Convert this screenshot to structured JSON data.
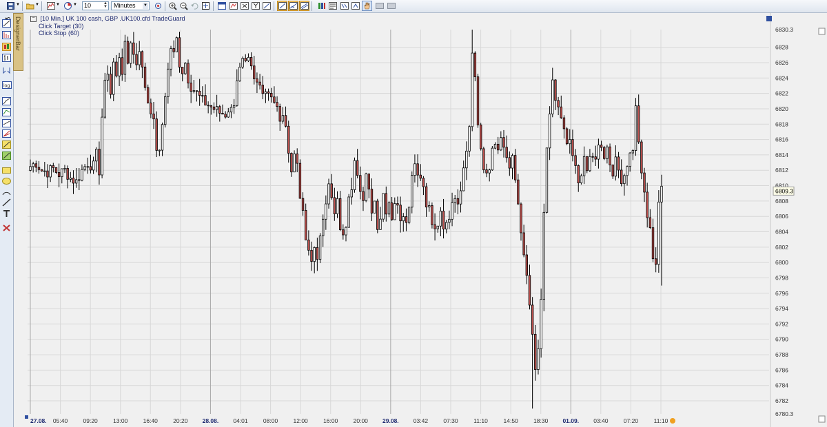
{
  "toolbar": {
    "bar_value": "10",
    "period_unit": "Minutes"
  },
  "designer_bar": {
    "label": "DesignerBar"
  },
  "chart_header": {
    "instrument": "[10 Min.] UK 100 cash, GBP  .UK100.cfd TradeGuard",
    "line2": "Click Target  (30)",
    "line3": "Click Stop  (60)"
  },
  "chart_data": {
    "type": "candlestick",
    "title": "[10 Min.] UK 100 cash, GBP  .UK100.cfd TradeGuard",
    "ylim": [
      6780.3,
      6830.3
    ],
    "y_axis_top_label": "6830.3",
    "y_axis_bottom_label": "6780.3",
    "current_price": "6809.3",
    "y_ticks": [
      "6828",
      "6826",
      "6824",
      "6822",
      "6820",
      "6818",
      "6816",
      "6814",
      "6812",
      "6810",
      "6808",
      "6806",
      "6804",
      "6802",
      "6800",
      "6798",
      "6796",
      "6794",
      "6792",
      "6790",
      "6788",
      "6786",
      "6784",
      "6782"
    ],
    "x_ticks": [
      "27.08.",
      "05:40",
      "09:20",
      "13:00",
      "16:40",
      "20:20",
      "28.08.",
      "04:01",
      "08:00",
      "12:00",
      "16:00",
      "20:00",
      "29.08.",
      "03:42",
      "07:30",
      "11:10",
      "14:50",
      "18:30",
      "01.09.",
      "03:40",
      "07:20",
      "11:10"
    ],
    "date_ticks": [
      "27.08.",
      "28.08.",
      "29.08.",
      "01.09."
    ],
    "close_path": [
      [
        0,
        6812.5
      ],
      [
        2,
        6813
      ],
      [
        4,
        6812
      ],
      [
        6,
        6811.8
      ],
      [
        8,
        6812.2
      ],
      [
        10,
        6811.5
      ],
      [
        12,
        6812
      ],
      [
        14,
        6811
      ],
      [
        16,
        6810.5
      ],
      [
        18,
        6812
      ],
      [
        20,
        6813
      ],
      [
        22,
        6812.5
      ],
      [
        23,
        6814
      ],
      [
        24,
        6812
      ],
      [
        25,
        6819
      ],
      [
        26,
        6823
      ],
      [
        27,
        6825
      ],
      [
        28,
        6822
      ],
      [
        29,
        6826
      ],
      [
        30,
        6824
      ],
      [
        31,
        6827
      ],
      [
        32,
        6825
      ],
      [
        33,
        6828
      ],
      [
        34,
        6826
      ],
      [
        35,
        6829
      ],
      [
        36,
        6827
      ],
      [
        37,
        6826
      ],
      [
        38,
        6828
      ],
      [
        39,
        6825
      ],
      [
        40,
        6823
      ],
      [
        41,
        6821
      ],
      [
        42,
        6820
      ],
      [
        43,
        6818
      ],
      [
        44,
        6815
      ],
      [
        45,
        6814
      ],
      [
        46,
        6818
      ],
      [
        47,
        6822
      ],
      [
        48,
        6825
      ],
      [
        49,
        6828
      ],
      [
        50,
        6827
      ],
      [
        51,
        6829
      ],
      [
        52,
        6826
      ],
      [
        53,
        6825
      ],
      [
        54,
        6826
      ],
      [
        55,
        6824
      ],
      [
        56,
        6823
      ],
      [
        58,
        6822
      ],
      [
        60,
        6821
      ],
      [
        62,
        6820.5
      ],
      [
        64,
        6820
      ],
      [
        66,
        6819.5
      ],
      [
        68,
        6819.3
      ],
      [
        69,
        6820
      ],
      [
        70,
        6819.8
      ],
      [
        71,
        6821
      ],
      [
        72,
        6824
      ],
      [
        73,
        6825
      ],
      [
        74,
        6826
      ],
      [
        75,
        6825.5
      ],
      [
        76,
        6826
      ],
      [
        77,
        6825
      ],
      [
        78,
        6823.5
      ],
      [
        80,
        6823
      ],
      [
        82,
        6822.5
      ],
      [
        84,
        6822
      ],
      [
        85,
        6821
      ],
      [
        86,
        6820
      ],
      [
        87,
        6818
      ],
      [
        88,
        6819.5
      ],
      [
        89,
        6817
      ],
      [
        90,
        6815
      ],
      [
        91,
        6812
      ],
      [
        92,
        6814
      ],
      [
        93,
        6813
      ],
      [
        94,
        6809
      ],
      [
        95,
        6806
      ],
      [
        96,
        6803
      ],
      [
        97,
        6801
      ],
      [
        98,
        6800
      ],
      [
        99,
        6802
      ],
      [
        100,
        6801
      ],
      [
        101,
        6803
      ],
      [
        102,
        6805
      ],
      [
        103,
        6808
      ],
      [
        104,
        6811
      ],
      [
        105,
        6809
      ],
      [
        106,
        6806
      ],
      [
        107,
        6808
      ],
      [
        108,
        6804
      ],
      [
        109,
        6803
      ],
      [
        110,
        6805
      ],
      [
        111,
        6808
      ],
      [
        112,
        6810
      ],
      [
        113,
        6814
      ],
      [
        114,
        6812
      ],
      [
        115,
        6810
      ],
      [
        116,
        6808
      ],
      [
        117,
        6811
      ],
      [
        118,
        6809
      ],
      [
        119,
        6807
      ],
      [
        120,
        6808
      ],
      [
        121,
        6805
      ],
      [
        122,
        6806
      ],
      [
        123,
        6809
      ],
      [
        124,
        6807
      ],
      [
        125,
        6808
      ],
      [
        126,
        6806
      ],
      [
        127,
        6808
      ],
      [
        128,
        6807
      ],
      [
        129,
        6806
      ],
      [
        130,
        6806.5
      ],
      [
        131,
        6806
      ],
      [
        132,
        6807
      ],
      [
        133,
        6812
      ],
      [
        134,
        6813
      ],
      [
        135,
        6812
      ],
      [
        136,
        6811
      ],
      [
        137,
        6810
      ],
      [
        138,
        6808
      ],
      [
        139,
        6807
      ],
      [
        140,
        6805
      ],
      [
        141,
        6804
      ],
      [
        142,
        6805
      ],
      [
        143,
        6806
      ],
      [
        144,
        6804
      ],
      [
        145,
        6805
      ],
      [
        146,
        6806
      ],
      [
        147,
        6808
      ],
      [
        148,
        6809
      ],
      [
        149,
        6807
      ],
      [
        150,
        6810
      ],
      [
        151,
        6813
      ],
      [
        152,
        6815
      ],
      [
        153,
        6818
      ],
      [
        154,
        6828
      ],
      [
        155,
        6824
      ],
      [
        156,
        6818
      ],
      [
        157,
        6815
      ],
      [
        158,
        6812
      ],
      [
        159,
        6811
      ],
      [
        160,
        6812
      ],
      [
        161,
        6815
      ],
      [
        162,
        6816
      ],
      [
        163,
        6814
      ],
      [
        164,
        6816
      ],
      [
        165,
        6815
      ],
      [
        166,
        6813
      ],
      [
        167,
        6812
      ],
      [
        168,
        6814
      ],
      [
        169,
        6810
      ],
      [
        170,
        6807
      ],
      [
        171,
        6804
      ],
      [
        172,
        6801
      ],
      [
        173,
        6798
      ],
      [
        174,
        6794
      ],
      [
        175,
        6790
      ],
      [
        176,
        6786
      ],
      [
        177,
        6788
      ],
      [
        178,
        6795
      ],
      [
        179,
        6806
      ],
      [
        180,
        6815
      ],
      [
        181,
        6820
      ],
      [
        182,
        6823
      ],
      [
        183,
        6821
      ],
      [
        184,
        6820
      ],
      [
        185,
        6819
      ],
      [
        186,
        6817
      ],
      [
        187,
        6815
      ],
      [
        188,
        6816
      ],
      [
        189,
        6814
      ],
      [
        190,
        6812
      ],
      [
        191,
        6810
      ],
      [
        192,
        6812
      ],
      [
        193,
        6814
      ],
      [
        194,
        6812
      ],
      [
        195,
        6813
      ],
      [
        196,
        6813.5
      ],
      [
        197,
        6814
      ],
      [
        198,
        6815
      ],
      [
        199,
        6815.5
      ],
      [
        200,
        6814
      ],
      [
        201,
        6815
      ],
      [
        202,
        6813
      ],
      [
        203,
        6812
      ],
      [
        204,
        6813
      ],
      [
        205,
        6812
      ],
      [
        206,
        6811
      ],
      [
        207,
        6811.5
      ],
      [
        208,
        6813
      ],
      [
        209,
        6814
      ],
      [
        210,
        6815
      ],
      [
        211,
        6820
      ],
      [
        212,
        6816
      ],
      [
        213,
        6811
      ],
      [
        214,
        6809
      ],
      [
        215,
        6806
      ],
      [
        216,
        6804
      ],
      [
        217,
        6801
      ],
      [
        218,
        6800
      ],
      [
        219,
        6808
      ],
      [
        220,
        6809.3
      ]
    ],
    "n_bars": 221,
    "grid": true,
    "axis_side": "right"
  }
}
